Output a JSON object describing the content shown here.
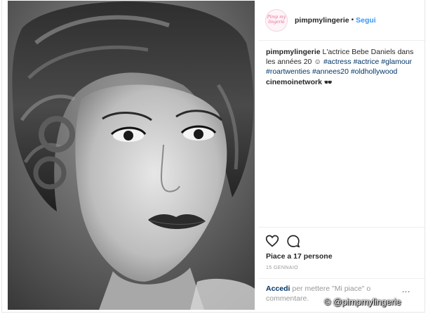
{
  "header": {
    "avatar_text": "Pimp my lingerie",
    "username": "pimpmylingerie",
    "separator": "•",
    "follow_label": "Segui"
  },
  "caption": {
    "username": "pimpmylingerie",
    "text": "L'actrice Bebe Daniels dans les années 20",
    "emoji": "☺",
    "hashtags": [
      "#actress",
      "#actrice",
      "#glamour",
      "#roartwenties",
      "#annees20",
      "#oldhollywood"
    ]
  },
  "comment": {
    "username": "cinemoinetwork",
    "emoji": "🕶"
  },
  "actions": {
    "like_icon": "heart-icon",
    "comment_icon": "comment-bubble-icon",
    "likes_text": "Piace a 17 persone",
    "date": "15 GENNAIO"
  },
  "login": {
    "link_text": "Accedi",
    "rest_text": "per mettere \"Mi piace\" o commentare.",
    "more_label": "..."
  },
  "watermark": "© @pimpmylingerie",
  "colors": {
    "link_blue": "#3897f0",
    "hashtag_blue": "#003569",
    "text": "#262626",
    "muted": "#999999"
  }
}
